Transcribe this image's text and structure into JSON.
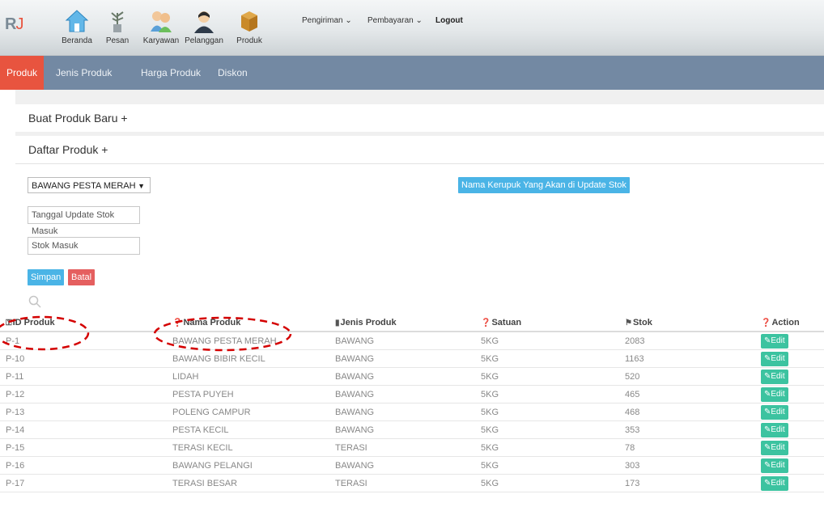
{
  "brand": {
    "letter": "R",
    "accent": "J"
  },
  "nav": {
    "items": [
      {
        "label": "Beranda",
        "icon": "home-icon"
      },
      {
        "label": "Pesan",
        "icon": "plant-icon"
      },
      {
        "label": "Karyawan",
        "icon": "employees-icon"
      },
      {
        "label": "Pelanggan",
        "icon": "customer-icon"
      },
      {
        "label": "Produk",
        "icon": "box-icon"
      }
    ],
    "menus": [
      {
        "label": "Pengiriman"
      },
      {
        "label": "Pembayaran"
      }
    ],
    "logout": "Logout"
  },
  "subnav": {
    "items": [
      {
        "label": "Produk"
      },
      {
        "label": "Jenis Produk"
      },
      {
        "label": "Harga Produk"
      },
      {
        "label": "Diskon"
      }
    ]
  },
  "panels": {
    "create": "Buat Produk Baru +",
    "list": "Daftar Produk +"
  },
  "form": {
    "product_select": "BAWANG PESTA MERAH",
    "update_hint": "Nama Kerupuk Yang Akan di Update Stok",
    "date_placeholder": "Tanggal Update Stok Masuk",
    "stock_placeholder": "Stok Masuk",
    "save": "Simpan",
    "cancel": "Batal"
  },
  "table": {
    "headers": [
      {
        "label": "ID Produk",
        "icon": "key-icon"
      },
      {
        "label": "Nama Produk",
        "icon": "question-icon"
      },
      {
        "label": "Jenis Produk",
        "icon": "bookmark-icon"
      },
      {
        "label": "Satuan",
        "icon": "question-icon"
      },
      {
        "label": "Stok",
        "icon": "flag-icon"
      },
      {
        "label": "Action",
        "icon": "question-icon"
      }
    ],
    "edit_label": "Edit",
    "rows": [
      {
        "id": "P-1",
        "nama": "BAWANG PESTA MERAH",
        "jenis": "BAWANG",
        "satuan": "5KG",
        "stok": "2083"
      },
      {
        "id": "P-10",
        "nama": "BAWANG BIBIR KECIL",
        "jenis": "BAWANG",
        "satuan": "5KG",
        "stok": "1163"
      },
      {
        "id": "P-11",
        "nama": "LIDAH",
        "jenis": "BAWANG",
        "satuan": "5KG",
        "stok": "520"
      },
      {
        "id": "P-12",
        "nama": "PESTA PUYEH",
        "jenis": "BAWANG",
        "satuan": "5KG",
        "stok": "465"
      },
      {
        "id": "P-13",
        "nama": "POLENG CAMPUR",
        "jenis": "BAWANG",
        "satuan": "5KG",
        "stok": "468"
      },
      {
        "id": "P-14",
        "nama": "PESTA KECIL",
        "jenis": "BAWANG",
        "satuan": "5KG",
        "stok": "353"
      },
      {
        "id": "P-15",
        "nama": "TERASI KECIL",
        "jenis": "TERASI",
        "satuan": "5KG",
        "stok": "78"
      },
      {
        "id": "P-16",
        "nama": "BAWANG PELANGI",
        "jenis": "BAWANG",
        "satuan": "5KG",
        "stok": "303"
      },
      {
        "id": "P-17",
        "nama": "TERASI BESAR",
        "jenis": "TERASI",
        "satuan": "5KG",
        "stok": "173"
      }
    ]
  },
  "colors": {
    "accent": "#e8543f",
    "subnav": "#7389a3",
    "primary": "#4ab4e6",
    "danger": "#e55f5f",
    "edit": "#3cc3a0"
  }
}
